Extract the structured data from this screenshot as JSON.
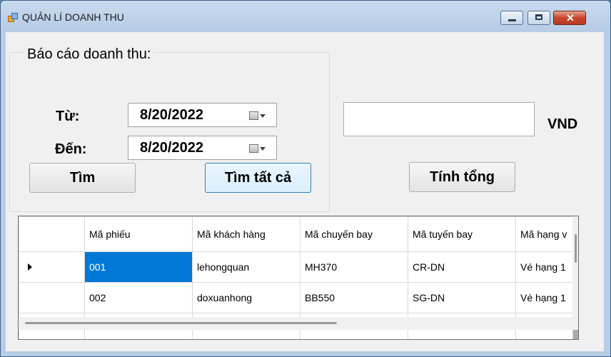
{
  "window": {
    "title": "QUẢN LÍ DOANH THU"
  },
  "report": {
    "group_title": "Báo cáo doanh thu:",
    "from_label": "Từ:",
    "from_value": "8/20/2022",
    "to_label": "Đến:",
    "to_value": "8/20/2022",
    "search_label": "Tìm",
    "search_all_label": "Tìm tất cả"
  },
  "total": {
    "value": "",
    "currency": "VND",
    "button_label": "Tính tổng"
  },
  "grid": {
    "headers": [
      "Mã phiếu",
      "Mã khách hàng",
      "Mã chuyến bay",
      "Mã tuyến bay",
      "Mã hạng v"
    ],
    "rows": [
      [
        "001",
        "lehongquan",
        "MH370",
        "CR-DN",
        "Vé hạng 1"
      ],
      [
        "002",
        "doxuanhong",
        "BB550",
        "SG-DN",
        "Vé hạng 1"
      ]
    ]
  },
  "icons": {
    "app": "app-form-icon",
    "calendar": "calendar-dropdown-icon",
    "row_pointer": "current-row-arrow-icon"
  }
}
